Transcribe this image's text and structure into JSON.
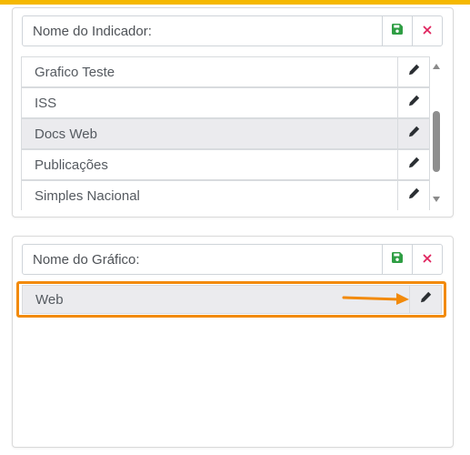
{
  "colors": {
    "accent": "#f5b800",
    "save": "#2f9e44",
    "delete": "#e0245e",
    "highlight": "#f28a0a",
    "edit": "#2b2f33"
  },
  "icons": {
    "save": "save-icon",
    "delete": "close-icon",
    "edit": "pencil-icon"
  },
  "indicator": {
    "placeholder": "Nome do Indicador:",
    "items": [
      {
        "label": "Grafico Teste",
        "selected": false
      },
      {
        "label": "ISS",
        "selected": false
      },
      {
        "label": "Docs Web",
        "selected": true
      },
      {
        "label": "Publicações",
        "selected": false
      },
      {
        "label": "Simples Nacional",
        "selected": false
      }
    ]
  },
  "chart": {
    "placeholder": "Nome do Gráfico:",
    "items": [
      {
        "label": "Web",
        "selected": true
      }
    ]
  }
}
